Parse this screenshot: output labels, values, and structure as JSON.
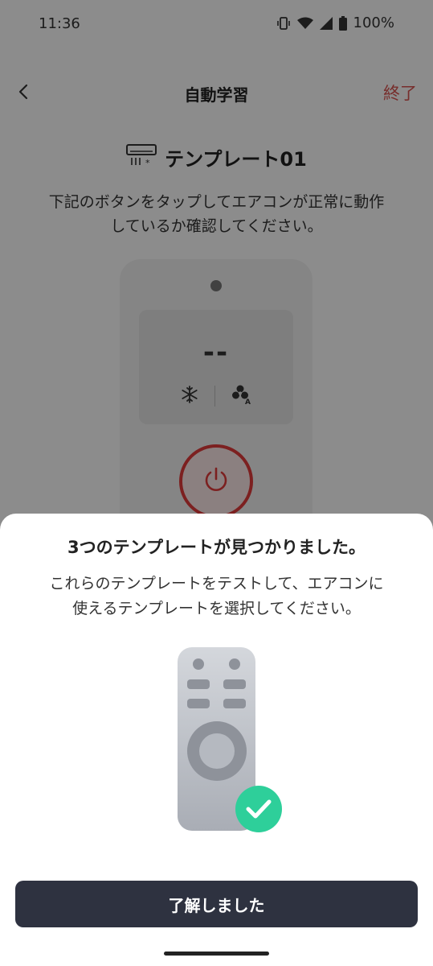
{
  "status_bar": {
    "time": "11:36",
    "battery_percent": "100%",
    "icons": [
      "vibrate-icon",
      "wifi-icon",
      "signal-icon",
      "battery-icon"
    ]
  },
  "nav": {
    "back_icon": "chevron-left-icon",
    "title": "自動学習",
    "end_label": "終了"
  },
  "template": {
    "icon": "air-conditioner-icon",
    "name": "テンプレート01"
  },
  "instruction": {
    "line1": "下記のボタンをタップしてエアコンが正常に動作",
    "line2": "しているか確認してください。"
  },
  "remote": {
    "display_value": "--",
    "mode_icon": "snowflake-icon",
    "fan_icon": "fan-auto-icon",
    "power_icon": "power-icon"
  },
  "sheet": {
    "title": "3つのテンプレートが見つかりました。",
    "desc_line1": "これらのテンプレートをテストして、エアコンに",
    "desc_line2": "使えるテンプレートを選択してください。",
    "illustration_icon": "remote-check-icon",
    "confirm_label": "了解しました"
  },
  "colors": {
    "accent_red": "#e23b3b",
    "end_text": "#d9534f",
    "button_dark": "#2e3240",
    "check_green": "#2ecf9a"
  }
}
